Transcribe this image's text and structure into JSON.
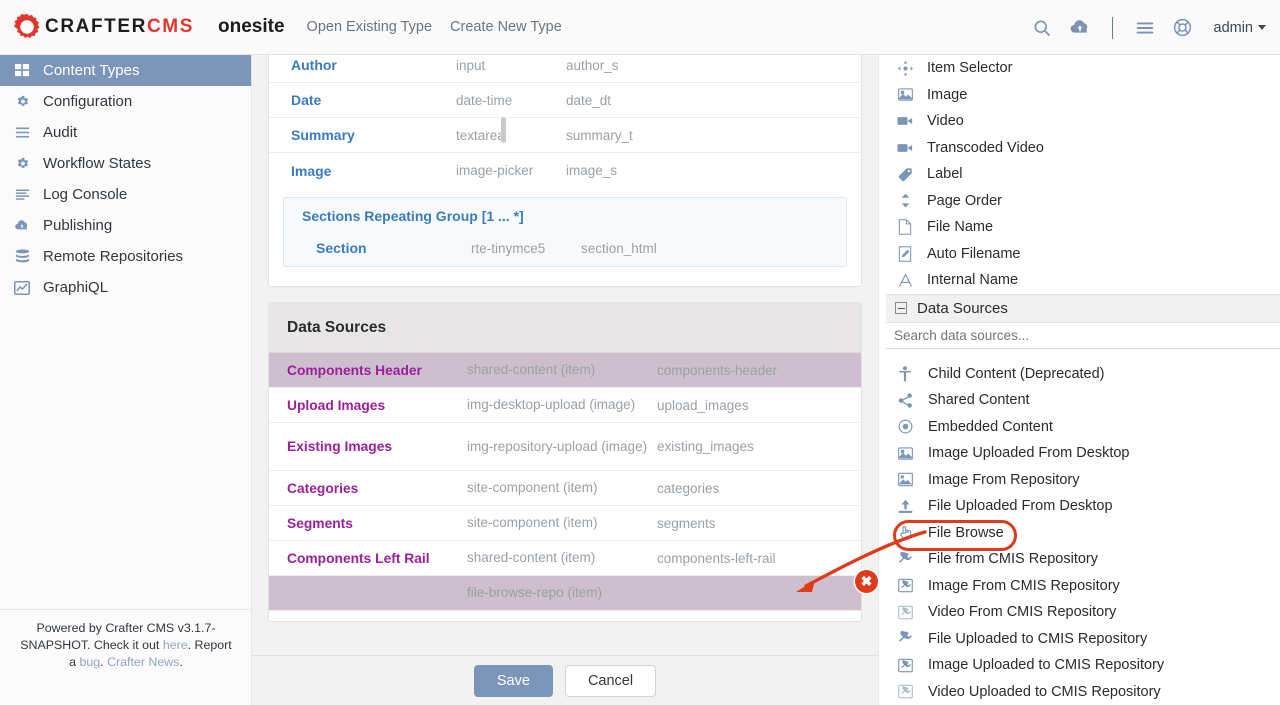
{
  "topbar": {
    "logo_main": "CRAFTER",
    "logo_accent": "CMS",
    "site_name": "onesite",
    "nav": [
      {
        "label": "Open Existing Type"
      },
      {
        "label": "Create New Type"
      }
    ],
    "icons": [
      {
        "name": "search-icon"
      },
      {
        "name": "cloud-upload-icon"
      },
      {
        "name": "hamburger-menu-icon"
      },
      {
        "name": "help-lifebuoy-icon"
      }
    ],
    "user": "admin"
  },
  "sidebar": {
    "items": [
      {
        "label": "Content Types",
        "icon": "grid-icon",
        "active": true
      },
      {
        "label": "Configuration",
        "icon": "gear-icon",
        "active": false
      },
      {
        "label": "Audit",
        "icon": "list-icon",
        "active": false
      },
      {
        "label": "Workflow States",
        "icon": "gear-icon",
        "active": false
      },
      {
        "label": "Log Console",
        "icon": "lines-icon",
        "active": false
      },
      {
        "label": "Publishing",
        "icon": "cloud-icon",
        "active": false
      },
      {
        "label": "Remote Repositories",
        "icon": "database-icon",
        "active": false
      },
      {
        "label": "GraphiQL",
        "icon": "chart-line-icon",
        "active": false
      }
    ],
    "footer": {
      "line1_a": "Powered by Crafter CMS v3.1.7-SNAPSHOT. Check it out ",
      "line1_link": "here",
      "line1_b": ".",
      "line2_a": "Report a ",
      "line2_link1": "bug",
      "line2_mid": ". ",
      "line2_link2": "Crafter News",
      "line2_b": "."
    }
  },
  "form": {
    "fields": [
      {
        "label": "Author",
        "type": "input",
        "name": "author_s"
      },
      {
        "label": "Date",
        "type": "date-time",
        "name": "date_dt"
      },
      {
        "label": "Summary",
        "type": "textarea",
        "name": "summary_t"
      },
      {
        "label": "Image",
        "type": "image-picker",
        "name": "image_s"
      }
    ],
    "repeating_group": {
      "title": "Sections Repeating Group [1 ... *]",
      "row": {
        "label": "Section",
        "type": "rte-tinymce5",
        "name": "section_html"
      }
    }
  },
  "data_sources_panel": {
    "title": "Data Sources",
    "rows": [
      {
        "label": "Components Header",
        "type": "shared-content (item)",
        "name": "components-header",
        "selected": true,
        "tall": false
      },
      {
        "label": "Upload Images",
        "type": "img-desktop-upload (image)",
        "name": "upload_images",
        "selected": false,
        "tall": false
      },
      {
        "label": "Existing Images",
        "type": "img-repository-upload (image)",
        "name": "existing_images",
        "selected": false,
        "tall": true
      },
      {
        "label": "Categories",
        "type": "site-component (item)",
        "name": "categories",
        "selected": false,
        "tall": false
      },
      {
        "label": "Segments",
        "type": "site-component (item)",
        "name": "segments",
        "selected": false,
        "tall": false
      },
      {
        "label": "Components Left Rail",
        "type": "shared-content (item)",
        "name": "components-left-rail",
        "selected": false,
        "tall": false
      },
      {
        "label": "",
        "type": "file-browse-repo (item)",
        "name": "",
        "selected": true,
        "tall": false
      }
    ]
  },
  "actions": {
    "save_label": "Save",
    "cancel_label": "Cancel"
  },
  "palette": {
    "controls": [
      {
        "label": "Item Selector",
        "icon": "move-arrows-icon"
      },
      {
        "label": "Image",
        "icon": "image-icon"
      },
      {
        "label": "Video",
        "icon": "video-camera-icon"
      },
      {
        "label": "Transcoded Video",
        "icon": "video-camera-icon"
      },
      {
        "label": "Label",
        "icon": "tag-icon"
      },
      {
        "label": "Page Order",
        "icon": "sort-updown-icon"
      },
      {
        "label": "File Name",
        "icon": "file-icon"
      },
      {
        "label": "Auto Filename",
        "icon": "file-pencil-icon"
      },
      {
        "label": "Internal Name",
        "icon": "letter-a-icon"
      }
    ],
    "section_title": "Data Sources",
    "collapse_icon": "minus-box-icon",
    "search_placeholder": "Search data sources...",
    "data_sources": [
      {
        "label": "Child Content (Deprecated)",
        "icon": "person-icon",
        "highlighted": false
      },
      {
        "label": "Shared Content",
        "icon": "share-nodes-icon",
        "highlighted": false
      },
      {
        "label": "Embedded Content",
        "icon": "target-dot-icon",
        "highlighted": false
      },
      {
        "label": "Image Uploaded From Desktop",
        "icon": "image-icon",
        "highlighted": false
      },
      {
        "label": "Image From Repository",
        "icon": "image-repo-icon",
        "highlighted": false
      },
      {
        "label": "File Uploaded From Desktop",
        "icon": "upload-icon",
        "highlighted": false
      },
      {
        "label": "File Browse",
        "icon": "hand-pointer-icon",
        "highlighted": true
      },
      {
        "label": "File from CMIS Repository",
        "icon": "plug-icon",
        "highlighted": false
      },
      {
        "label": "Image From CMIS Repository",
        "icon": "image-plug-icon",
        "highlighted": false
      },
      {
        "label": "Video From CMIS Repository",
        "icon": "video-plug-icon",
        "highlighted": false
      },
      {
        "label": "File Uploaded to CMIS Repository",
        "icon": "plug-icon",
        "highlighted": false
      },
      {
        "label": "Image Uploaded to CMIS Repository",
        "icon": "image-plug-icon",
        "highlighted": false
      },
      {
        "label": "Video Uploaded to CMIS Repository",
        "icon": "video-plug-icon",
        "highlighted": false
      }
    ]
  },
  "annotations": {
    "highlight_color": "#e03a1a",
    "delete_button_label": "✖"
  },
  "colors": {
    "accent_blue": "#7b96b8",
    "field_label_blue": "#3a7bbf",
    "ds_label_purple": "#9c1f9c",
    "ds_row_selected": "#cdbfcd",
    "logo_red": "#e2352f"
  }
}
